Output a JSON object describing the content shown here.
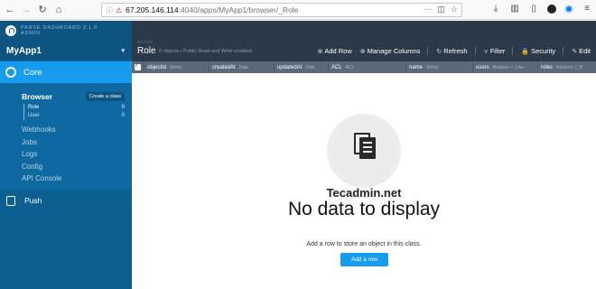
{
  "browser": {
    "url_host": "67.205.146.114",
    "url_path": ":4040/apps/MyApp1/browser/_Role",
    "more_icon": "ellipsis-icon",
    "icons": [
      "download-icon",
      "library-icon",
      "sidebar-icon",
      "account-icon",
      "extension-icon"
    ]
  },
  "sidebar": {
    "logo_line1": "PARSE DASHBOARD 2.1.0",
    "logo_line2": "ADMIN",
    "app_name": "MyApp1",
    "core_label": "Core",
    "browser_label": "Browser",
    "create_class_label": "Create a class",
    "classes": [
      {
        "name": "Role",
        "count": "0"
      },
      {
        "name": "User",
        "count": "0"
      }
    ],
    "items": [
      "Webhooks",
      "Jobs",
      "Logs",
      "Config",
      "API Console"
    ],
    "push_label": "Push"
  },
  "header": {
    "section_label": "CLASS",
    "title": "Role",
    "subtitle": "0 objects • Public Read and Write enabled",
    "actions": [
      {
        "icon": "⊕",
        "label": "Add Row"
      },
      {
        "icon": "⊕",
        "label": "Manage Columns"
      },
      {
        "icon": "↻",
        "label": "Refresh"
      },
      {
        "icon": "⋎",
        "label": "Filter"
      },
      {
        "icon": "🔒",
        "label": "Security"
      },
      {
        "icon": "✎",
        "label": "Edit"
      }
    ]
  },
  "columns": [
    {
      "name": "objectId",
      "type": "String"
    },
    {
      "name": "createdAt",
      "type": "Date"
    },
    {
      "name": "updatedAt",
      "type": "Date"
    },
    {
      "name": "ACL",
      "type": "ACL"
    },
    {
      "name": "name",
      "type": "String"
    },
    {
      "name": "users",
      "type": "Relation <_Use"
    },
    {
      "name": "roles",
      "type": "Relation <_R"
    }
  ],
  "empty": {
    "watermark": "Tecadmin.net",
    "title": "No data to display",
    "description": "Add a row to store an object in this class.",
    "button_label": "Add a row"
  },
  "colors": {
    "sidebar": "#0e69a1",
    "sidebar_active": "#169cee",
    "header": "#2b3a4a",
    "columns": "#5a6a7b",
    "accent": "#169cee"
  }
}
